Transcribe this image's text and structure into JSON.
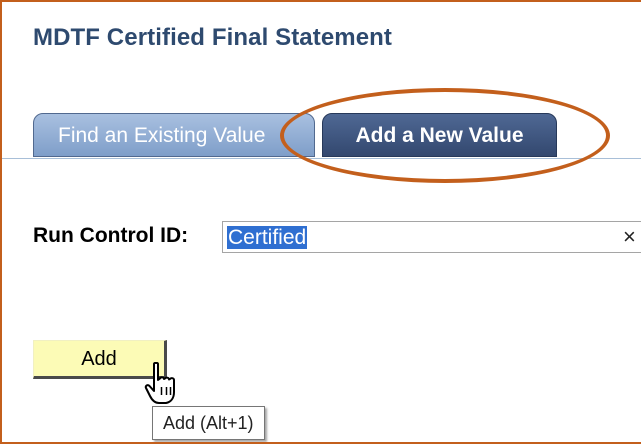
{
  "page": {
    "title": "MDTF Certified Final Statement"
  },
  "tabs": [
    {
      "label": "Find an Existing Value",
      "active": false
    },
    {
      "label": "Add a New Value",
      "active": true
    }
  ],
  "form": {
    "run_control_label": "Run Control ID:",
    "run_control_value": "Certified",
    "clear_glyph": "×"
  },
  "actions": {
    "add_label": "Add",
    "add_tooltip": "Add (Alt+1)"
  },
  "annotation": {
    "highlight_color": "#c35f1c",
    "highlight_target": "Add a New Value"
  },
  "icons": {
    "cursor": "hand-pointer-icon"
  },
  "colors": {
    "title": "#2e4a6f",
    "tab_inactive": "#8faed6",
    "tab_active": "#3c5178",
    "button_fill": "#fcfbb6",
    "selection": "#2f6fd1"
  }
}
